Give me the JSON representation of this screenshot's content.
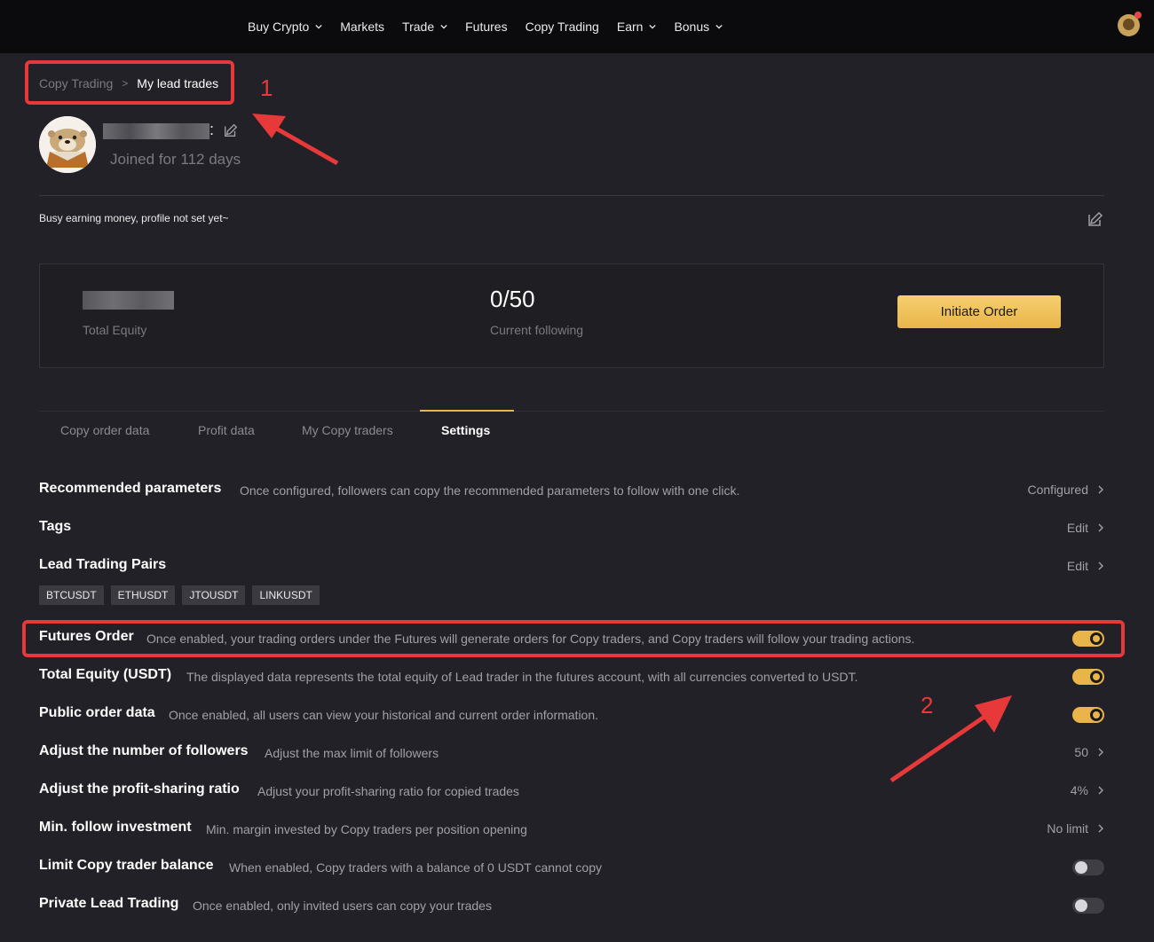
{
  "nav": {
    "items": [
      {
        "label": "Buy Crypto",
        "has_dropdown": true
      },
      {
        "label": "Markets",
        "has_dropdown": false
      },
      {
        "label": "Trade",
        "has_dropdown": true
      },
      {
        "label": "Futures",
        "has_dropdown": false
      },
      {
        "label": "Copy Trading",
        "has_dropdown": false
      },
      {
        "label": "Earn",
        "has_dropdown": true
      },
      {
        "label": "Bonus",
        "has_dropdown": true
      }
    ]
  },
  "breadcrumb": {
    "parent": "Copy Trading",
    "separator": ">",
    "current": "My lead trades"
  },
  "annotations": {
    "marker1": "1",
    "marker2": "2",
    "color": "#e8393a"
  },
  "profile": {
    "username_suffix": ":",
    "joined": "Joined for 112 days",
    "bio": "Busy earning money, profile not set yet~"
  },
  "stats": {
    "total_equity_label": "Total Equity",
    "following_value": "0/50",
    "following_label": "Current following",
    "initiate_button": "Initiate Order"
  },
  "tabs": [
    {
      "label": "Copy order data",
      "active": false
    },
    {
      "label": "Profit data",
      "active": false
    },
    {
      "label": "My Copy traders",
      "active": false
    },
    {
      "label": "Settings",
      "active": true
    }
  ],
  "settings": {
    "recommended": {
      "title": "Recommended parameters",
      "desc": "Once configured, followers can copy the recommended parameters to follow with one click.",
      "value": "Configured"
    },
    "tags": {
      "title": "Tags",
      "value": "Edit"
    },
    "lead_pairs": {
      "title": "Lead Trading Pairs",
      "value": "Edit",
      "pairs": [
        "BTCUSDT",
        "ETHUSDT",
        "JTOUSDT",
        "LINKUSDT"
      ]
    },
    "futures_order": {
      "title": "Futures Order",
      "desc": "Once enabled, your trading orders under the Futures will generate orders for Copy traders, and Copy traders will follow your trading actions.",
      "enabled": true
    },
    "total_equity": {
      "title": "Total Equity (USDT)",
      "desc": "The displayed data represents the total equity of Lead trader in the futures account, with all currencies converted to USDT.",
      "enabled": true
    },
    "public_order": {
      "title": "Public order data",
      "desc": "Once enabled, all users can view your historical and current order information.",
      "enabled": true
    },
    "followers": {
      "title": "Adjust the number of followers",
      "desc": "Adjust the max limit of followers",
      "value": "50"
    },
    "profit_sharing": {
      "title": "Adjust the profit-sharing ratio",
      "desc": "Adjust your profit-sharing ratio for copied trades",
      "value": "4%"
    },
    "min_follow": {
      "title": "Min. follow investment",
      "desc": "Min. margin invested by Copy traders per position opening",
      "value": "No limit"
    },
    "limit_balance": {
      "title": "Limit Copy trader balance",
      "desc": "When enabled, Copy traders with a balance of 0 USDT cannot copy",
      "enabled": false
    },
    "private_lead": {
      "title": "Private Lead Trading",
      "desc": "Once enabled, only invited users can copy your trades",
      "enabled": false
    }
  },
  "colors": {
    "accent": "#e9b54a",
    "background": "#212127",
    "nav_background": "#0b0b0d"
  }
}
